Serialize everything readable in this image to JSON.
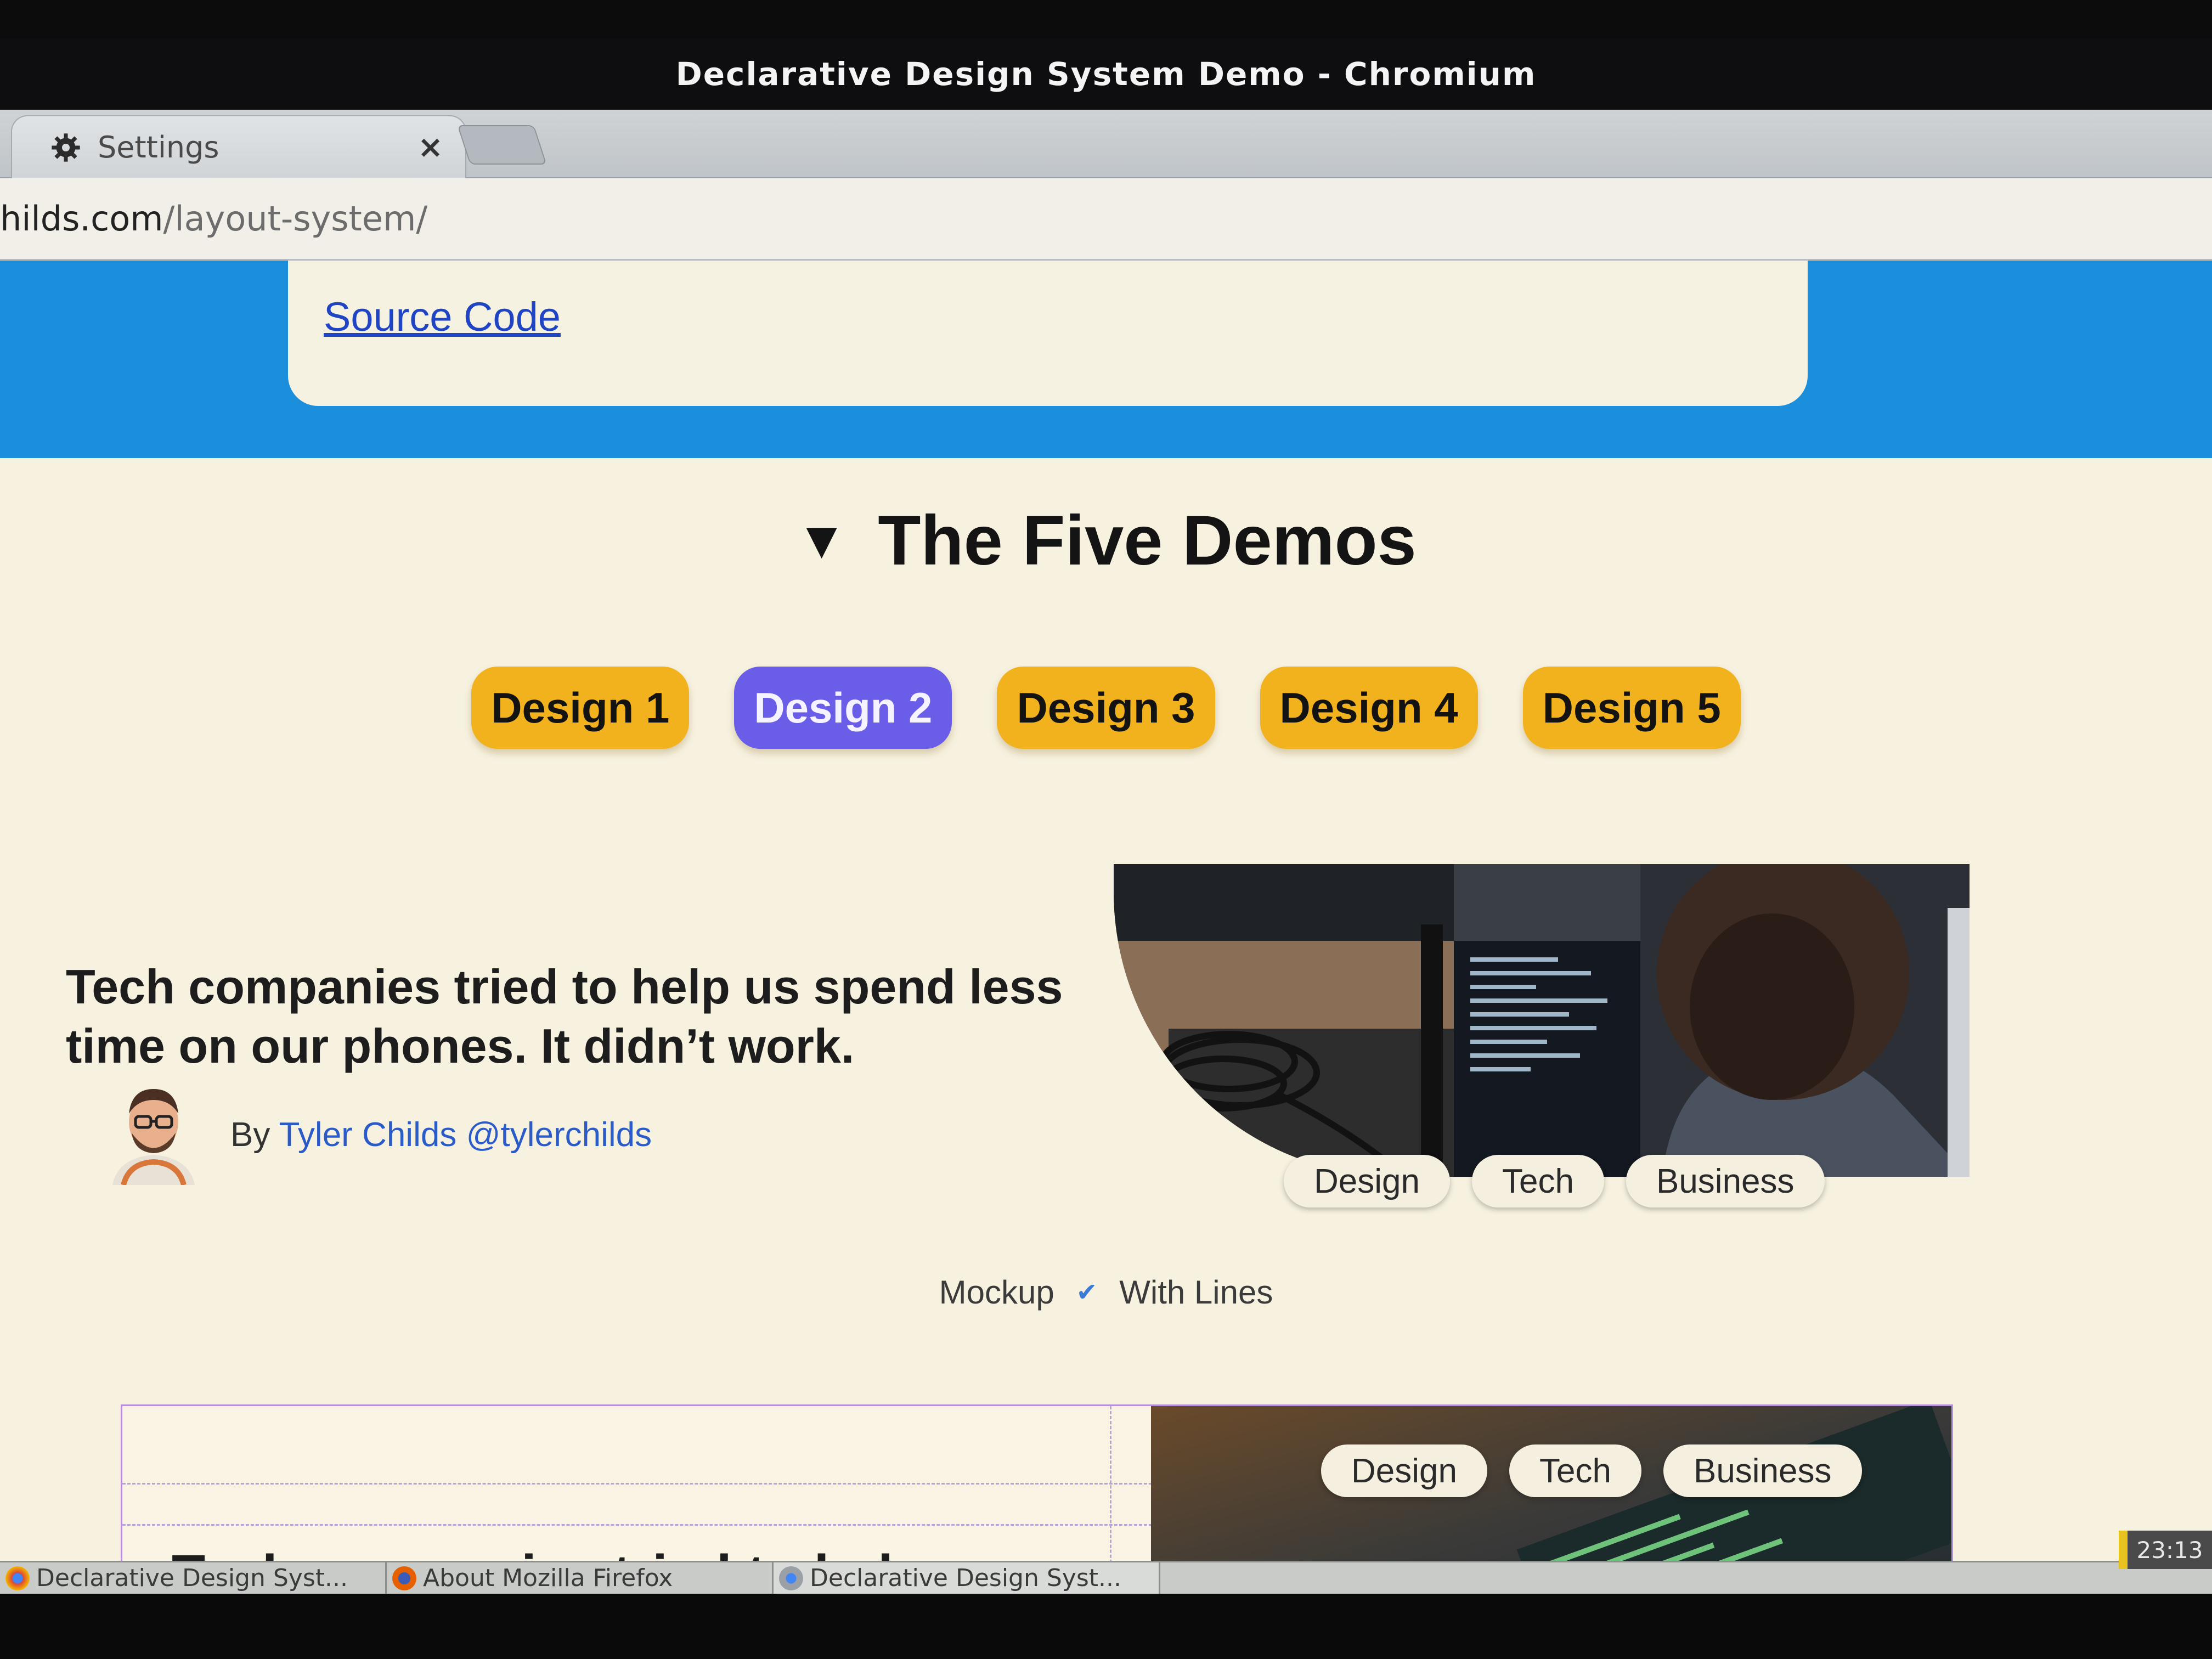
{
  "window": {
    "title": "Declarative Design System Demo - Chromium"
  },
  "tabs": [
    {
      "label": "Settings",
      "icon": "gear-icon",
      "close": "×"
    }
  ],
  "address_bar": {
    "host": "hilds.com",
    "path": "/layout-system/"
  },
  "banner": {
    "source_link": "Source Code"
  },
  "demos": {
    "heading": "The Five Demos",
    "toggle_glyph": "▼",
    "buttons": [
      "Design 1",
      "Design 2",
      "Design 3",
      "Design 4",
      "Design 5"
    ],
    "active_index": 1
  },
  "article": {
    "headline_line1": "Tech companies tried to help us spend less",
    "headline_line2": "time on our phones. It didn’t work.",
    "byline_prefix": "By",
    "author": "Tyler Childs",
    "handle": "@tylerchilds",
    "tags": [
      "Design",
      "Tech",
      "Business"
    ]
  },
  "mockup_controls": {
    "mockup_label": "Mockup",
    "check_glyph": "✔",
    "lines_label": "With Lines"
  },
  "article2": {
    "headline": "Tech companies tried to help us"
  },
  "taskbar": {
    "items": [
      "Declarative Design Syst...",
      "About Mozilla Firefox",
      "Declarative Design Syst..."
    ],
    "clock": "23:13"
  },
  "colors": {
    "accent_blue": "#1c8fdc",
    "button_yellow": "#f2b21d",
    "button_active": "#6a5ee8",
    "link": "#2a5bc8"
  }
}
